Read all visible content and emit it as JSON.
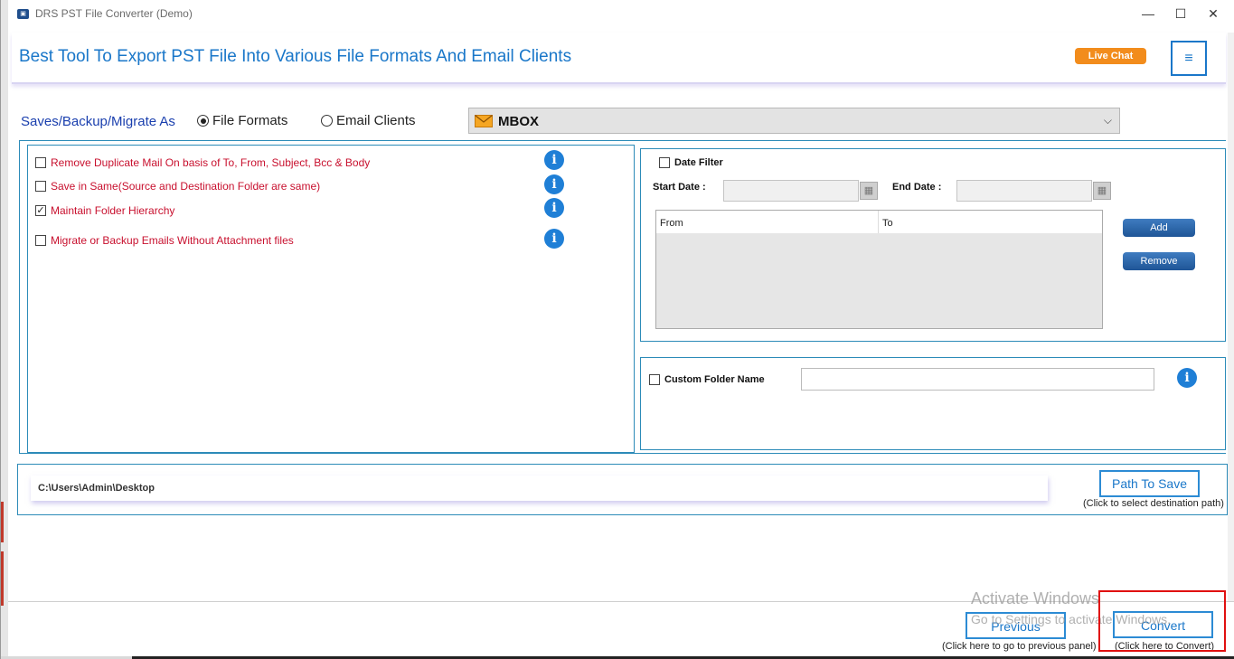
{
  "window": {
    "title": "DRS PST File Converter (Demo)",
    "minimize": "—",
    "maximize": "☐",
    "close": "✕"
  },
  "header": {
    "title": "Best Tool To Export PST File Into Various File Formats And Email Clients",
    "live_chat": "Live Chat",
    "menu": "≡"
  },
  "save_as": {
    "label": "Saves/Backup/Migrate As",
    "option_file_formats": "File Formats",
    "option_email_clients": "Email Clients",
    "selected_option": "File Formats",
    "format_value": "MBOX",
    "format_icon": "envelope-icon"
  },
  "options": [
    {
      "label": "Remove Duplicate Mail On basis of To, From, Subject, Bcc & Body",
      "checked": false
    },
    {
      "label": "Save in Same(Source and Destination Folder are same)",
      "checked": false
    },
    {
      "label": "Maintain Folder Hierarchy",
      "checked": true
    },
    {
      "label": "Migrate or Backup Emails Without Attachment files",
      "checked": false
    }
  ],
  "date_filter": {
    "label": "Date Filter",
    "checked": false,
    "start_label": "Start Date :",
    "end_label": "End Date :",
    "start_value": "",
    "end_value": "",
    "col_from": "From",
    "col_to": "To",
    "add": "Add",
    "remove": "Remove"
  },
  "custom_folder": {
    "label": "Custom Folder Name",
    "checked": false,
    "value": ""
  },
  "path": {
    "value": "C:\\Users\\Admin\\Desktop",
    "button": "Path To Save",
    "hint": "(Click to select destination path)"
  },
  "footer": {
    "previous": "Previous",
    "previous_hint": "(Click here to go to previous panel)",
    "convert": "Convert",
    "convert_hint": "(Click here to Convert)"
  },
  "watermark": {
    "line1": "Activate Windows",
    "line2": "Go to Settings to activate Windows."
  },
  "colors": {
    "accent": "#1a77c9",
    "option_text": "#c8102e",
    "live_chat": "#f28c1c",
    "highlight": "#e01010"
  }
}
